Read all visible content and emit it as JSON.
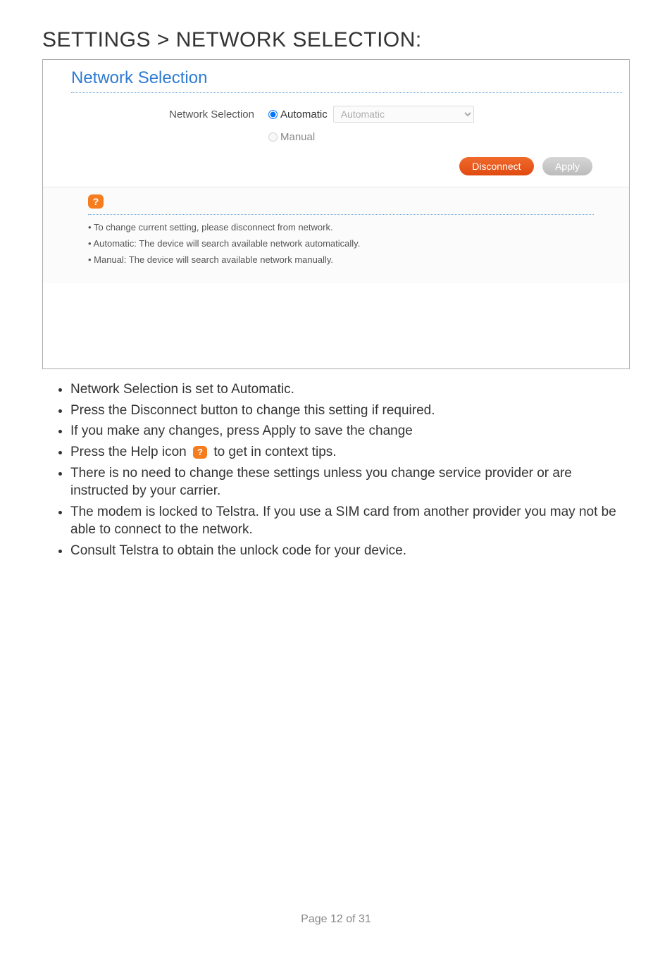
{
  "heading": "SETTINGS > NETWORK SELECTION:",
  "panel": {
    "title": "Network Selection",
    "label": "Network Selection",
    "radio_automatic": "Automatic",
    "radio_manual": "Manual",
    "select_options": [
      "Automatic"
    ],
    "select_value": "Automatic",
    "btn_disconnect": "Disconnect",
    "btn_apply": "Apply"
  },
  "help": {
    "items": [
      "To change current setting, please disconnect from network.",
      "Automatic: The device will search available network automatically.",
      "Manual: The device will search available network manually."
    ]
  },
  "doc_bullets": {
    "b0": "Network Selection is set to Automatic.",
    "b1": "Press the Disconnect button to change this setting if required.",
    "b2": "If you make any changes, press Apply to save the change",
    "b3_pre": "Press the Help icon ",
    "b3_post": " to get in context tips.",
    "b4": "There is no need to change these settings unless you change service provider or are instructed by your carrier.",
    "b5": "The modem is locked to Telstra. If you use a SIM card from another provider you may not be able to connect to the network.",
    "b6": "Consult Telstra to obtain the unlock code for your device."
  },
  "footer": "Page 12 of 31"
}
